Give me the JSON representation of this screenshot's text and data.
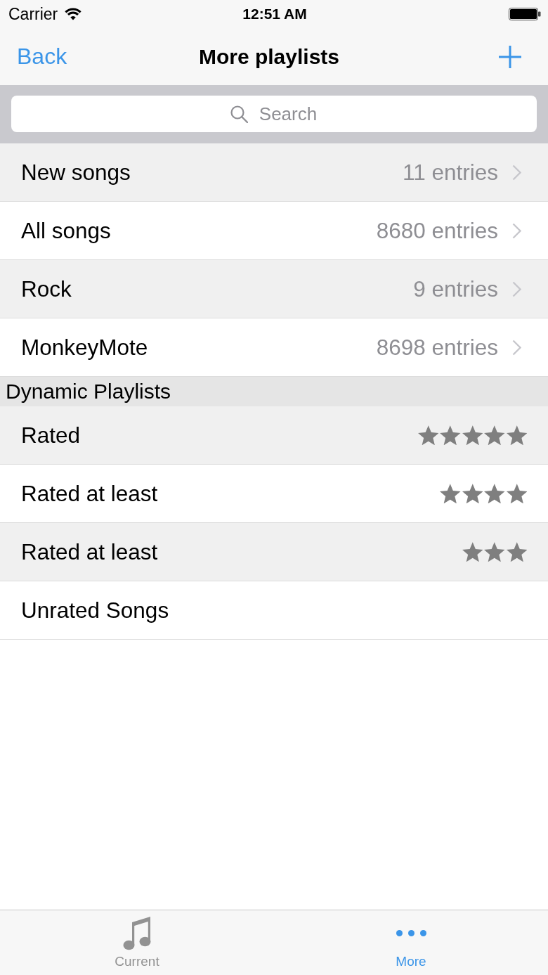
{
  "status_bar": {
    "carrier": "Carrier",
    "time": "12:51 AM"
  },
  "nav_bar": {
    "back": "Back",
    "title": "More playlists"
  },
  "search": {
    "placeholder": "Search"
  },
  "sections": [
    {
      "rows": [
        {
          "kind": "count",
          "name": "New songs",
          "detail": "11 entries"
        },
        {
          "kind": "count",
          "name": "All songs",
          "detail": "8680 entries"
        },
        {
          "kind": "count",
          "name": "Rock",
          "detail": "9 entries"
        },
        {
          "kind": "count",
          "name": "MonkeyMote",
          "detail": "8698 entries"
        }
      ]
    },
    {
      "header": "Dynamic Playlists",
      "rows": [
        {
          "kind": "rating",
          "name": "Rated",
          "stars": 5
        },
        {
          "kind": "rating",
          "name": "Rated at least",
          "stars": 4
        },
        {
          "kind": "rating",
          "name": "Rated at least",
          "stars": 3
        },
        {
          "kind": "plain",
          "name": "Unrated Songs"
        }
      ]
    }
  ],
  "tab_bar": {
    "tabs": [
      {
        "label": "Current",
        "selected": false
      },
      {
        "label": "More",
        "selected": true
      }
    ]
  }
}
